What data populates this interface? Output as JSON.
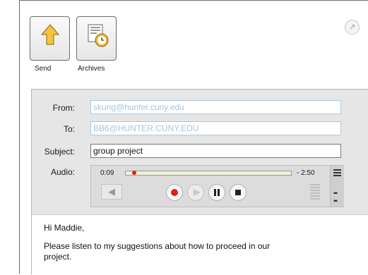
{
  "toolbar": {
    "send_label": "Send",
    "archives_label": "Archives",
    "pin_icon": "pin-icon"
  },
  "compose": {
    "from_label": "From:",
    "from_value": "skung@hunter.cuny.edu",
    "to_label": "To:",
    "to_value": "BB6@HUNTER.CUNY.EDU",
    "subject_label": "Subject:",
    "subject_value": "group project",
    "audio_label": "Audio:"
  },
  "audio": {
    "elapsed": "0:09",
    "remaining": "- 2:50",
    "progress_fraction": 0.05,
    "controls": [
      "record",
      "play",
      "pause",
      "stop"
    ]
  },
  "message": {
    "greeting": "Hi Maddie,",
    "line1": "Please listen to my suggestions about how to proceed in our",
    "line2": "project."
  },
  "colors": {
    "record_red": "#e02020",
    "field_border_blue": "#aac7e3",
    "panel_gray": "#e6e6e6"
  }
}
